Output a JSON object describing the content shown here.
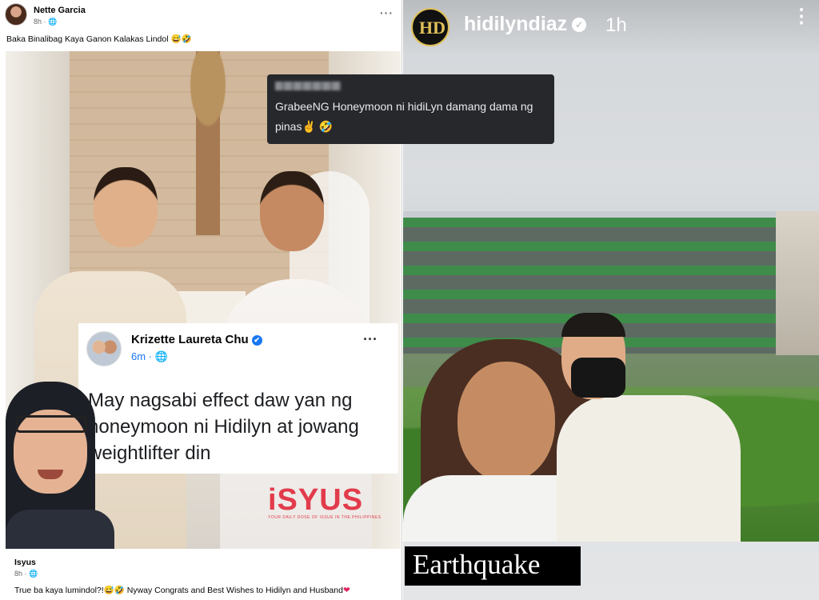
{
  "facebook_post": {
    "poster_name": "Nette Garcia",
    "poster_meta": "8h · 🌐",
    "more": "···",
    "caption": "Baka Binalibag Kaya Ganon Kalakas Lindol 😅🤣",
    "embedded_card": {
      "name": "Krizette Laureta Chu",
      "verified": "✔",
      "time": "6m · 🌐",
      "more": "···",
      "text": "May nagsabi effect daw yan ng honeymoon ni Hidilyn at jowang weightlifter din"
    },
    "watermark": {
      "brand": "iSYUS",
      "tagline": "YOUR DAILY DOSE OF ISSUE IN THE PHILIPPINES"
    },
    "footer": {
      "name": "Isyus",
      "meta": "8h · 🌐",
      "text": "True ba kaya lumindol?!😅🤣 Nyway Congrats and Best Wishes to Hidilyn and Husband",
      "heart": "❤"
    }
  },
  "instagram_story": {
    "username": "hidilyndiaz",
    "verified": "✓",
    "time": "1h",
    "more": "⋮",
    "avatar_logo": "HD",
    "comment": {
      "text": "GrabeeNG Honeymoon ni hidiLyn damang dama ng pinas✌️ 🤣"
    },
    "tag": "Earthquake"
  },
  "colors": {
    "facebook_blue": "#1877f2",
    "isyus_red": "#e23b4b",
    "story_gold": "#e0c05a"
  }
}
